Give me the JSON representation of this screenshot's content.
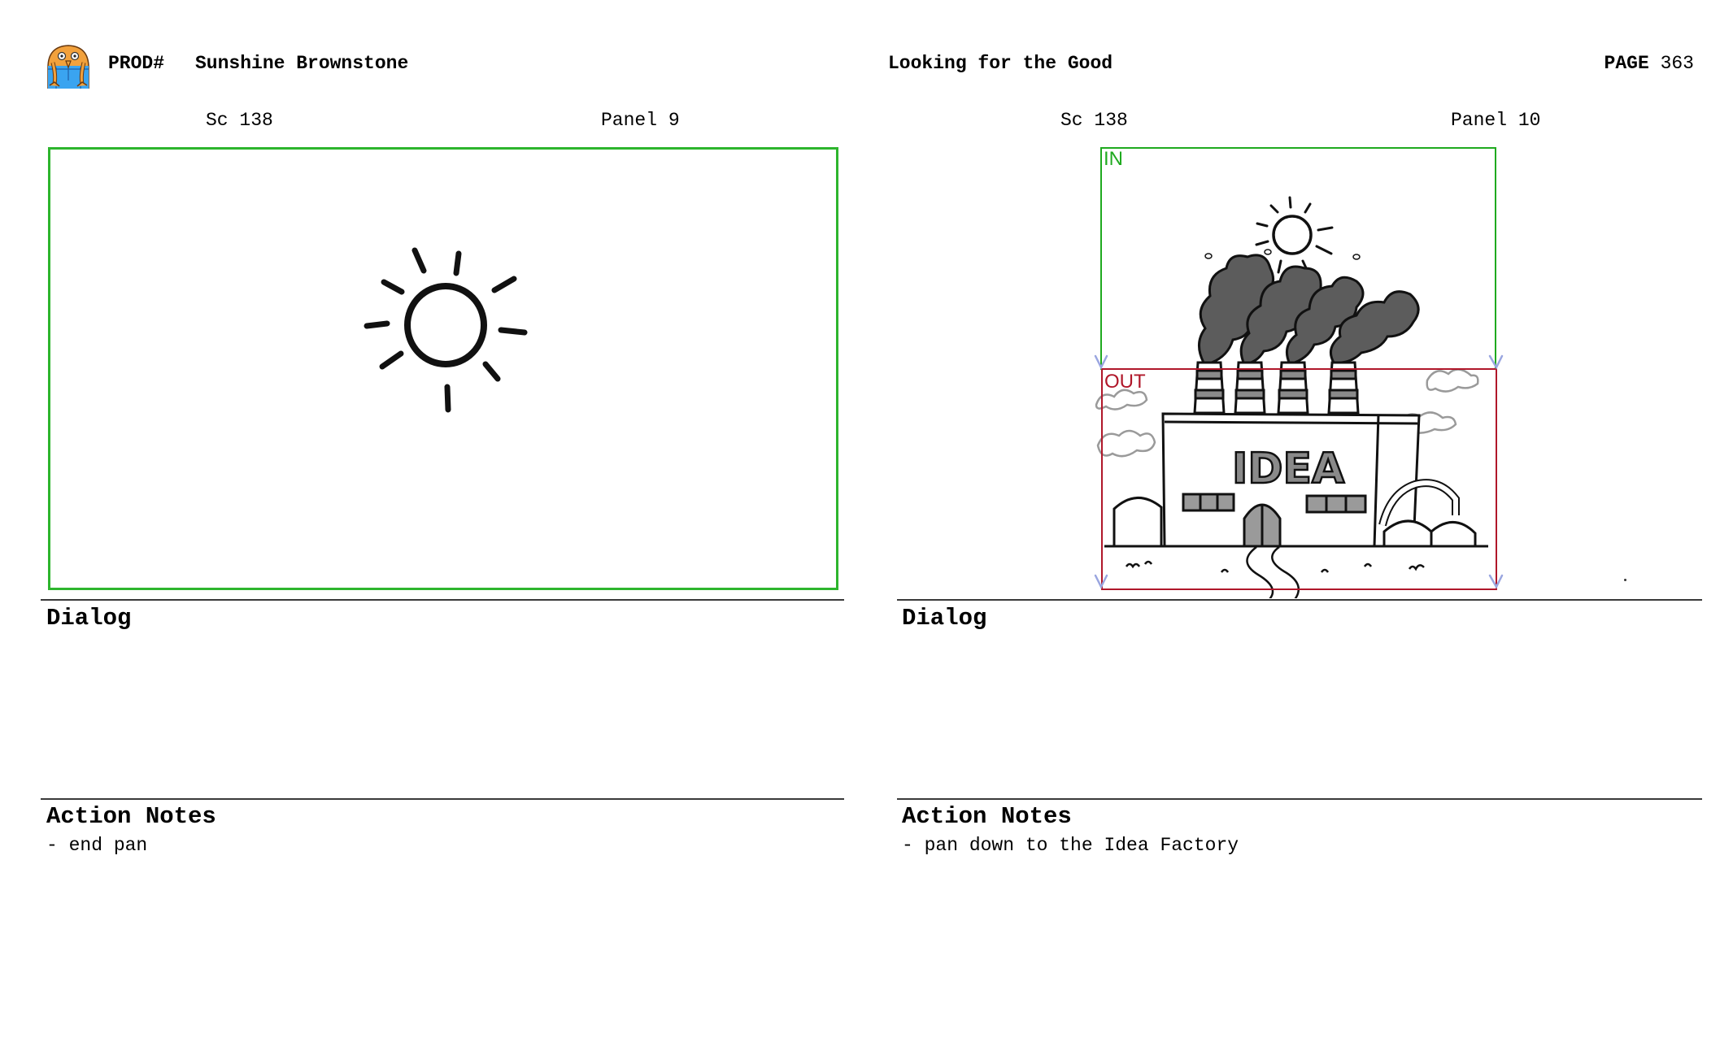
{
  "header": {
    "logo_icon": "owl-character-logo-icon",
    "prod_label": "PROD#",
    "show_title": "Sunshine Brownstone",
    "episode_title": "Looking for the Good",
    "page_label": "PAGE",
    "page_number": "363"
  },
  "panels": [
    {
      "scene": "Sc 138",
      "panel": "Panel 9",
      "frame_color": "#2db52d",
      "drawing": "sun",
      "dialog_label": "Dialog",
      "dialog_text": "",
      "action_label": "Action Notes",
      "action_text": "- end pan"
    },
    {
      "scene": "Sc 138",
      "panel": "Panel 10",
      "in_label": "IN",
      "in_color": "#1faa1f",
      "out_label": "OUT",
      "out_color": "#b0172a",
      "drawing": "sun and Idea factory with smokestacks",
      "factory_sign": "IDEA",
      "dialog_label": "Dialog",
      "dialog_text": "",
      "action_label": "Action Notes",
      "action_text": "- pan down to the Idea Factory"
    }
  ]
}
